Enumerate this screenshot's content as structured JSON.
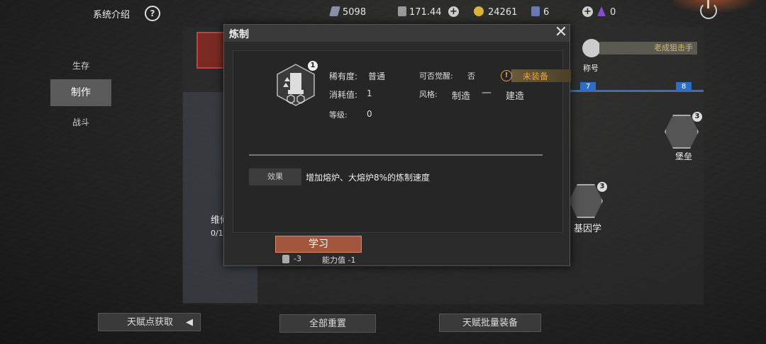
{
  "topbar": {
    "system_label": "系统介绍",
    "resources": [
      {
        "icon": "crystal-icon",
        "value": "5098"
      },
      {
        "icon": "ticket-icon",
        "value": "171.44"
      },
      {
        "icon": "gold-coin-icon",
        "value": "24261"
      },
      {
        "icon": "card-icon",
        "value": "6"
      },
      {
        "icon": "purple-gem-icon",
        "value": "0"
      }
    ]
  },
  "nav": {
    "items": [
      {
        "label": "生存"
      },
      {
        "label": "制作"
      },
      {
        "label": "战斗"
      }
    ]
  },
  "background": {
    "card_title": "维修",
    "card_progress": "0/12",
    "title_badge": "老成狙击手",
    "title_label": "称号",
    "node_fort": "堡垒",
    "node_gene": "基因学",
    "node_fort_level": "3",
    "node_gene_level": "3",
    "blue_badges": [
      "7",
      "8"
    ]
  },
  "modal": {
    "title": "炼制",
    "item_level_badge": "1",
    "rarity_label": "稀有度:",
    "rarity_value": "普通",
    "awaken_label": "可否觉醒:",
    "awaken_value": "否",
    "unequipped": "未装备",
    "cost_label": "消耗值:",
    "cost_value": "1",
    "style_label": "风格:",
    "style_from": "制造",
    "style_dash": "—",
    "style_to": "建造",
    "level_label": "等级:",
    "level_value": "0",
    "effect_tag": "效果",
    "effect_text": "增加熔炉、大熔炉8%的炼制速度",
    "learn_button": "学习",
    "cost_points": "-3",
    "ability_cost": "能力值 -1"
  },
  "bottom": {
    "talent_get": "天赋点获取",
    "reset_all": "全部重置",
    "batch_equip": "天赋批量装备"
  }
}
